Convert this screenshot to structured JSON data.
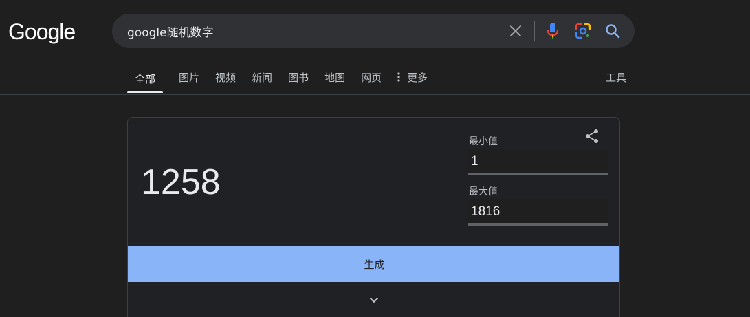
{
  "header": {
    "logo_text": "Google",
    "search": {
      "value": "google随机数字",
      "clear_icon": "close-icon",
      "voice_icon": "microphone-icon",
      "lens_icon": "google-lens-icon",
      "search_icon": "search-icon"
    }
  },
  "tabs": [
    {
      "label": "全部",
      "active": true
    },
    {
      "label": "图片"
    },
    {
      "label": "视频"
    },
    {
      "label": "新闻"
    },
    {
      "label": "图书"
    },
    {
      "label": "地图"
    },
    {
      "label": "网页"
    },
    {
      "label": "更多",
      "icon": "vertical-dots-icon"
    }
  ],
  "tools_label": "工具",
  "randomizer": {
    "result": "1258",
    "min_label": "最小值",
    "min_value": "1",
    "max_label": "最大值",
    "max_value": "1816",
    "generate_label": "生成",
    "share_icon": "share-icon",
    "expand_icon": "chevron-down-icon"
  },
  "colors": {
    "background": "#1f1f1f",
    "search_bg": "#303134",
    "accent_blue": "#8ab4f8",
    "mic_red": "#ea4335",
    "mic_blue": "#4285f4",
    "lens_yellow": "#fbbc04",
    "lens_green": "#34a853"
  }
}
